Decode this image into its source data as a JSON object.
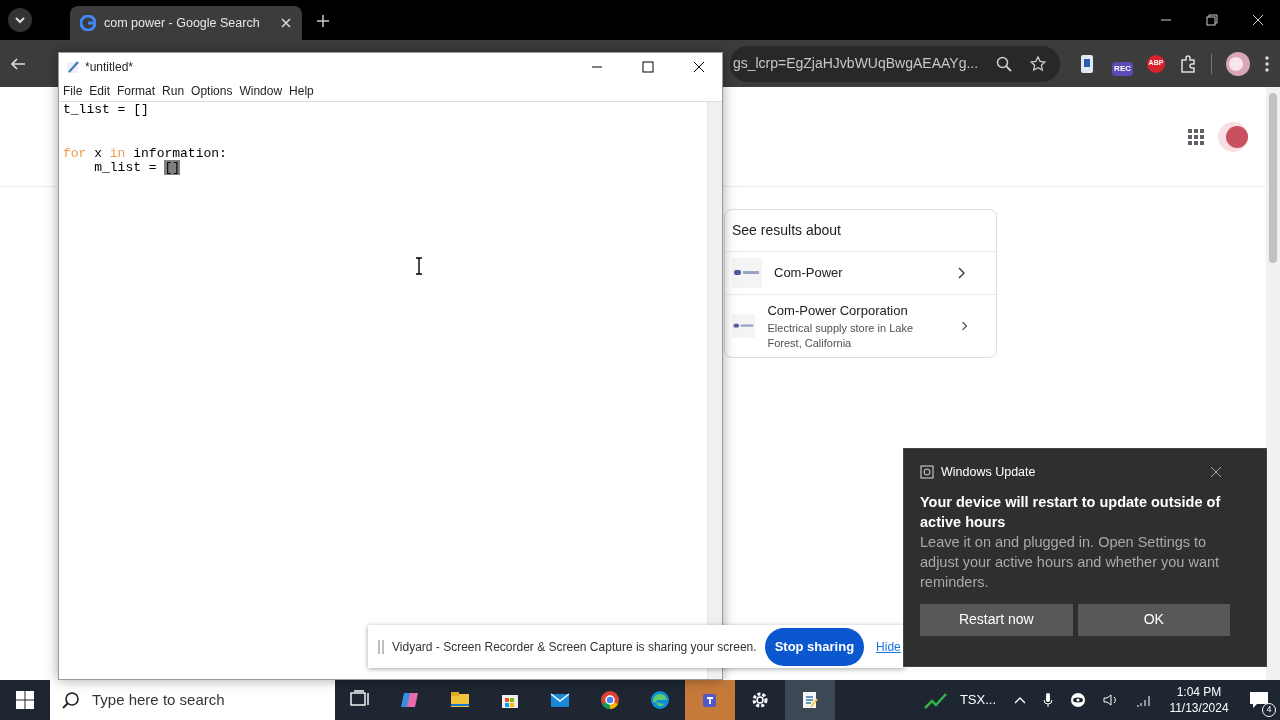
{
  "browser": {
    "tabs": [
      {
        "title": "com power - Google Search",
        "selected": true
      }
    ],
    "address_text": "gs_lcrp=EgZjaHJvbWUqBwgAEAAYg...",
    "extensions": [
      {
        "kind": "screen"
      },
      {
        "kind": "rec",
        "label": "REC"
      },
      {
        "kind": "abp",
        "label": "ABP"
      },
      {
        "kind": "puzzle"
      }
    ]
  },
  "knowledge_panel": {
    "heading": "See results about",
    "items": [
      {
        "title": "Com-Power"
      },
      {
        "title": "Com-Power Corporation",
        "subtitle": "Electrical supply store in Lake Forest, California"
      }
    ]
  },
  "editor": {
    "title": "*untitled*",
    "menu": [
      "File",
      "Edit",
      "Format",
      "Run",
      "Options",
      "Window",
      "Help"
    ],
    "lines": [
      {
        "kind": "code",
        "tokens": [
          {
            "text": "t_list = []",
            "kind": "plain"
          }
        ]
      },
      {
        "kind": "blank"
      },
      {
        "kind": "blank"
      },
      {
        "kind": "code",
        "tokens": [
          {
            "text": "for",
            "kind": "keyword"
          },
          {
            "text": " x ",
            "kind": "plain"
          },
          {
            "text": "in",
            "kind": "keyword"
          },
          {
            "text": " information:",
            "kind": "plain"
          }
        ]
      },
      {
        "kind": "code",
        "tokens": [
          {
            "text": "    m_list = ",
            "kind": "plain"
          },
          {
            "text": "[]",
            "kind": "selected"
          }
        ]
      }
    ]
  },
  "share_bar": {
    "message": "Vidyard - Screen Recorder & Screen Capture is sharing your screen.",
    "stop_button": "Stop sharing",
    "hide_link": "Hide"
  },
  "toast": {
    "app": "Windows Update",
    "title": "Your device will restart to update outside of active hours",
    "body": "Leave it on and plugged in. Open Settings to adjust your active hours and whether you want reminders.",
    "buttons": [
      "Restart now",
      "OK"
    ]
  },
  "taskbar": {
    "search_placeholder": "Type here to search",
    "apps": [
      {
        "kind": "taskview",
        "active": false,
        "flashing": false
      },
      {
        "kind": "copilot",
        "active": false,
        "flashing": false
      },
      {
        "kind": "files",
        "active": false,
        "flashing": false
      },
      {
        "kind": "store",
        "active": false,
        "flashing": false
      },
      {
        "kind": "mail",
        "active": false,
        "flashing": false
      },
      {
        "kind": "chrome",
        "active": false,
        "flashing": false
      },
      {
        "kind": "edge",
        "active": false,
        "flashing": false
      },
      {
        "kind": "teams",
        "active": false,
        "flashing": true
      },
      {
        "kind": "settings",
        "active": false,
        "flashing": false
      },
      {
        "kind": "idle",
        "active": true,
        "flashing": false
      }
    ],
    "widget": "TSX...",
    "time": "1:04 PM",
    "date": "11/13/2024",
    "notifications": "4"
  }
}
